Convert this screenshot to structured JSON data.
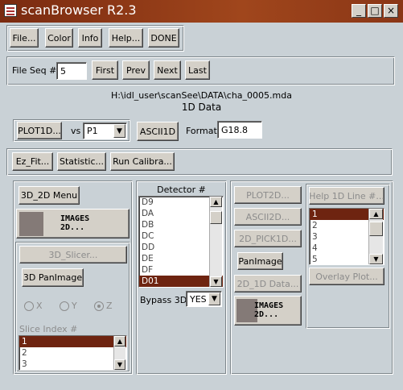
{
  "window": {
    "title": "scanBrowser R2.3",
    "controls": {
      "minimize": "_",
      "maximize": "□",
      "close": "×"
    }
  },
  "menu": {
    "file": "File...",
    "color": "Color",
    "info": "Info",
    "help": "Help...",
    "done": "DONE"
  },
  "fileseq": {
    "label": "File Seq #:",
    "value": "5",
    "first": "First",
    "prev": "Prev",
    "next": "Next",
    "last": "Last"
  },
  "filepath": "H:\\idl_user\\scanSee\\DATA\\cha_0005.mda",
  "section_title": "1D Data",
  "plot_row": {
    "plot1d": "PLOT1D...",
    "vs": "vs",
    "vs_value": "P1",
    "ascii1d": "ASCII1D",
    "format_label": "Format:",
    "format_value": "G18.8"
  },
  "tools": {
    "ezfit": "Ez_Fit...",
    "statistic": "Statistic...",
    "calibra": "Run Calibra..."
  },
  "left_panel": {
    "menu_3d2d": "3D_2D Menu",
    "images_text": "IMAGES\n2D...",
    "slicer": "3D_Slicer...",
    "panimage3d": "3D PanImage",
    "radios": [
      {
        "label": "X",
        "checked": false
      },
      {
        "label": "Y",
        "checked": false
      },
      {
        "label": "Z",
        "checked": true
      }
    ],
    "slice_label": "Slice Index #",
    "slice_items": [
      "1",
      "2",
      "3"
    ],
    "slice_selected": 0
  },
  "detector": {
    "title": "Detector #",
    "items": [
      "D9",
      "DA",
      "DB",
      "DC",
      "DD",
      "DE",
      "DF",
      "D01"
    ],
    "selected": 7,
    "bypass_label": "Bypass 3D",
    "bypass_value": "YES"
  },
  "right_panel": {
    "plot2d": "PLOT2D...",
    "ascii2d": "ASCII2D...",
    "pick1d": "2D_PICK1D...",
    "panimage": "PanImage",
    "data2d1d": "2D_1D Data...",
    "images_text": "IMAGES\n2D..."
  },
  "line_panel": {
    "help": "Help 1D Line #...",
    "items": [
      "1",
      "2",
      "3",
      "4",
      "5"
    ],
    "selected": 0,
    "overlay": "Overlay Plot..."
  }
}
